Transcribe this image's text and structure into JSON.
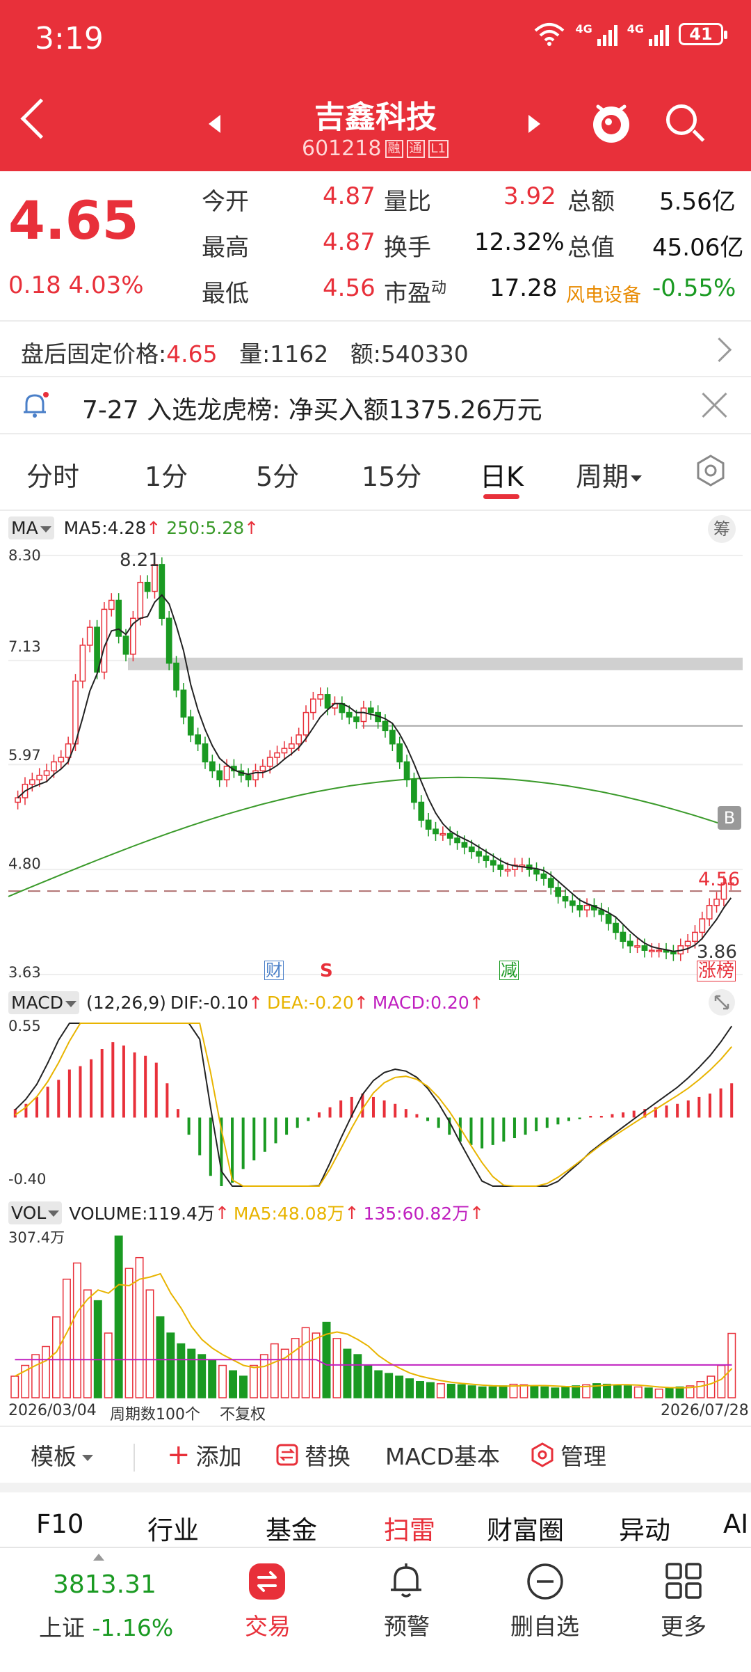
{
  "status_bar": {
    "time": "3:19",
    "network1": "4G",
    "network2": "4G",
    "battery": "41"
  },
  "header": {
    "name": "吉鑫科技",
    "code": "601218",
    "tag1": "融",
    "tag2": "通",
    "tag3": "L1"
  },
  "quote": {
    "price": "4.65",
    "change": "0.18 4.03%",
    "rows": [
      {
        "l1": "今开",
        "v1": "4.87",
        "l2": "量比",
        "v2": "3.92",
        "l3": "总额",
        "v3": "5.56亿"
      },
      {
        "l1": "最高",
        "v1": "4.87",
        "l2": "换手",
        "v2": "12.32%",
        "l3": "总值",
        "v3": "45.06亿"
      },
      {
        "l1": "最低",
        "v1": "4.56",
        "l2": "市盈",
        "l2sup": "动",
        "v2": "17.28",
        "l3": "风电设备",
        "v3": "-0.55%"
      }
    ]
  },
  "after_hours": {
    "label": "盘后固定价格:",
    "price": "4.65",
    "vol_label": "量:",
    "vol": "1162",
    "amt_label": "额:",
    "amt": "540330"
  },
  "notice": {
    "text": "7-27 入选龙虎榜: 净买入额1375.26万元"
  },
  "tabs": [
    "分时",
    "1分",
    "5分",
    "15分",
    "日K",
    "周期"
  ],
  "kchart": {
    "indicator": "MA",
    "ma5": "MA5:4.28",
    "ma250": "250:5.28",
    "chip_label": "筹",
    "axis": [
      "8.30",
      "7.13",
      "5.97",
      "4.80",
      "3.63"
    ],
    "high_label": "8.21",
    "low_label": "3.86",
    "last_label": "4.56",
    "b_marker": "B",
    "marks": [
      "财",
      "S",
      "减"
    ],
    "rank_tag": "涨榜"
  },
  "macd": {
    "label": "MACD",
    "params": "(12,26,9)",
    "dif": "DIF:-0.10",
    "dea": "DEA:-0.20",
    "macd": "MACD:0.20",
    "axis_top": "0.55",
    "axis_bottom": "-0.40"
  },
  "vol": {
    "label": "VOL",
    "volume": "VOLUME:119.4万",
    "ma5": "MA5:48.08万",
    "ma135": "135:60.82万",
    "axis_top": "307.4万"
  },
  "footer_axis": {
    "start": "2026/03/04",
    "period": "周期数100个",
    "adjust": "不复权",
    "end": "2026/07/28"
  },
  "template_bar": {
    "template": "模板",
    "add": "添加",
    "replace": "替换",
    "macd_basic": "MACD基本",
    "manage": "管理"
  },
  "nav2": [
    "F10",
    "行业",
    "基金",
    "扫雷",
    "财富圈",
    "异动",
    "AI"
  ],
  "dock": {
    "index_value": "3813.31",
    "index_name": "上证",
    "index_change": "-1.16%",
    "trade": "交易",
    "alert": "预警",
    "remove": "删自选",
    "more": "更多"
  },
  "colors": {
    "brand_red": "#e8303a",
    "up": "#e8303a",
    "down": "#1a9a22",
    "ma5": "#222222",
    "ma250": "#3a9a2a",
    "dea": "#e8b400",
    "macd_label": "#c020c0"
  },
  "chart_data": {
    "type": "candlestick",
    "title": "",
    "x_start": "2026/03/04",
    "x_end": "2026/07/28",
    "ylim": [
      3.63,
      8.3
    ],
    "close": [
      5.6,
      5.75,
      5.8,
      5.85,
      5.9,
      6.0,
      6.05,
      6.2,
      6.9,
      7.3,
      7.5,
      7.0,
      7.7,
      7.8,
      7.4,
      7.2,
      7.6,
      8.0,
      7.9,
      8.2,
      7.6,
      7.1,
      6.8,
      6.5,
      6.3,
      6.2,
      6.0,
      5.9,
      5.8,
      5.95,
      5.9,
      5.85,
      5.8,
      5.9,
      5.95,
      6.05,
      6.1,
      6.15,
      6.2,
      6.3,
      6.55,
      6.7,
      6.75,
      6.6,
      6.65,
      6.55,
      6.5,
      6.45,
      6.6,
      6.55,
      6.45,
      6.35,
      6.2,
      6.0,
      5.8,
      5.55,
      5.35,
      5.25,
      5.2,
      5.2,
      5.15,
      5.1,
      5.05,
      5.0,
      4.95,
      4.9,
      4.85,
      4.8,
      4.8,
      4.85,
      4.85,
      4.8,
      4.75,
      4.7,
      4.6,
      4.5,
      4.45,
      4.4,
      4.35,
      4.4,
      4.35,
      4.3,
      4.2,
      4.1,
      4.0,
      3.95,
      3.95,
      3.9,
      3.9,
      3.9,
      3.88,
      3.86,
      3.95,
      4.0,
      4.1,
      4.25,
      4.4,
      4.47,
      4.65,
      4.65
    ],
    "ma250_start": 4.5,
    "ma250_end": 5.28,
    "macd_values": [
      0.05,
      0.08,
      0.12,
      0.18,
      0.22,
      0.28,
      0.3,
      0.34,
      0.4,
      0.44,
      0.42,
      0.38,
      0.36,
      0.32,
      0.2,
      0.05,
      -0.1,
      -0.22,
      -0.34,
      -0.4,
      -0.38,
      -0.3,
      -0.25,
      -0.2,
      -0.15,
      -0.1,
      -0.06,
      -0.02,
      0.03,
      0.06,
      0.1,
      0.12,
      0.14,
      0.12,
      0.1,
      0.08,
      0.05,
      0.02,
      -0.02,
      -0.06,
      -0.1,
      -0.14,
      -0.16,
      -0.18,
      -0.16,
      -0.14,
      -0.12,
      -0.1,
      -0.08,
      -0.06,
      -0.04,
      -0.02,
      -0.01,
      0.01,
      0.01,
      0.02,
      0.03,
      0.04,
      0.05,
      0.06,
      0.07,
      0.08,
      0.1,
      0.12,
      0.14,
      0.17,
      0.2
    ],
    "volume_values": [
      40,
      60,
      80,
      95,
      150,
      220,
      250,
      200,
      180,
      120,
      300,
      240,
      260,
      200,
      150,
      120,
      100,
      90,
      80,
      70,
      60,
      50,
      40,
      60,
      80,
      100,
      90,
      110,
      130,
      120,
      140,
      110,
      90,
      80,
      60,
      50,
      45,
      40,
      35,
      30,
      28,
      26,
      25,
      24,
      22,
      20,
      20,
      22,
      25,
      24,
      22,
      20,
      18,
      20,
      22,
      24,
      26,
      25,
      24,
      22,
      20,
      18,
      16,
      18,
      20,
      22,
      30,
      40,
      60,
      119.4
    ]
  }
}
